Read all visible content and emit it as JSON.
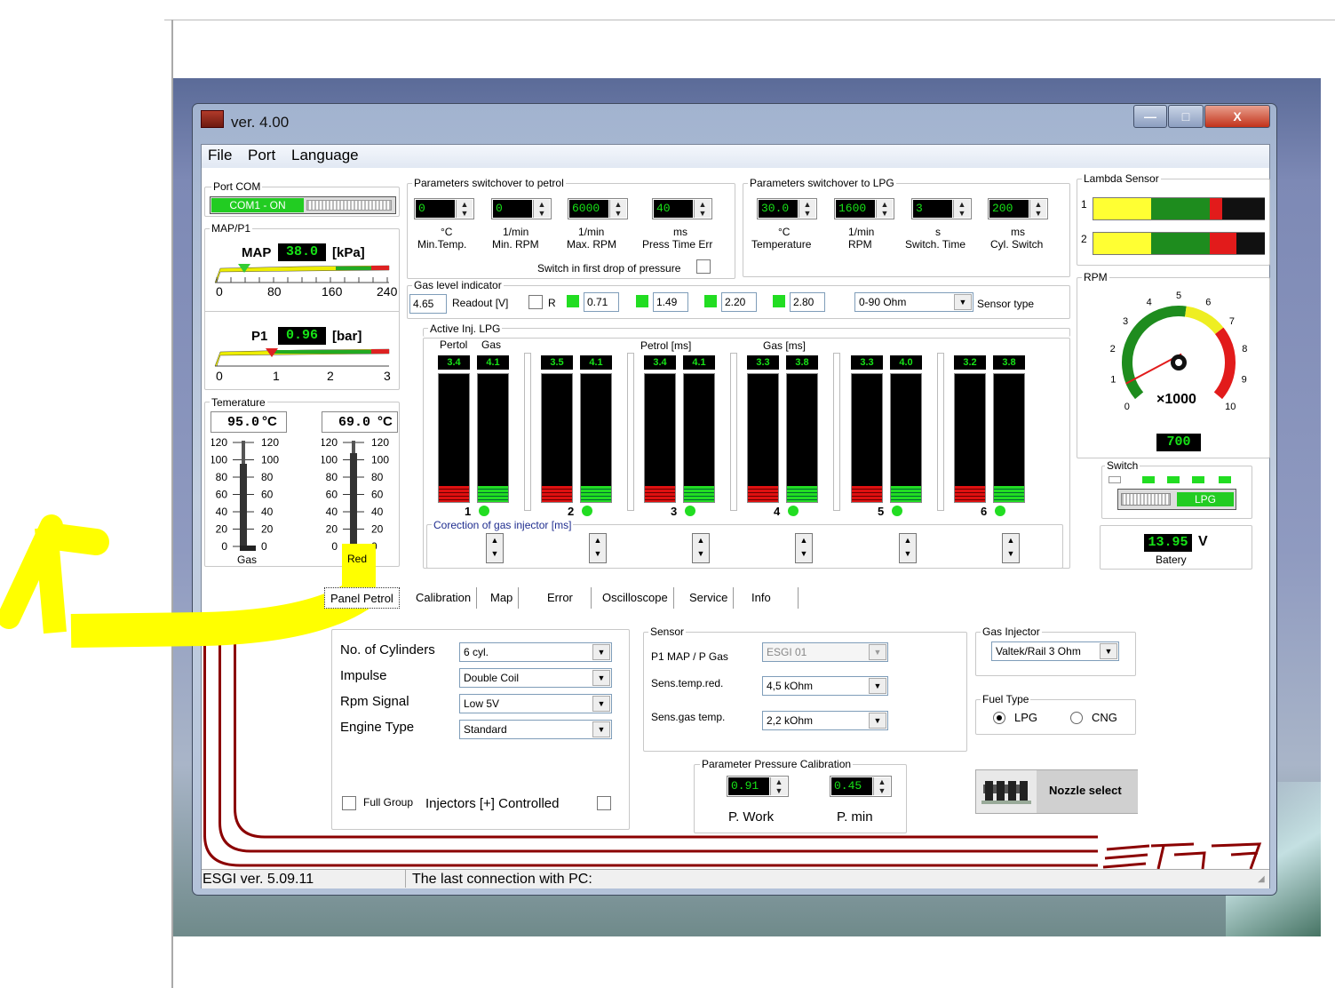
{
  "window": {
    "title": "ver. 4.00",
    "min_symbol": "—",
    "max_symbol": "□",
    "close_symbol": "X"
  },
  "menu": [
    "File",
    "Port",
    "Language"
  ],
  "port_com": {
    "legend": "Port COM",
    "status": "COM1 - ON"
  },
  "map_p1": {
    "legend": "MAP/P1",
    "map_label": "MAP",
    "map_value": "38.0",
    "map_unit": "[kPa]",
    "map_scale": [
      "0",
      "80",
      "160",
      "240"
    ],
    "map_level": 0.16,
    "p1_label": "P1",
    "p1_value": "0.96",
    "p1_unit": "[bar]",
    "p1_scale": [
      "0",
      "1",
      "2",
      "3"
    ],
    "p1_level": 0.32
  },
  "temperature": {
    "legend": "Temerature",
    "gas_value": "95.0",
    "red_value": "69.0",
    "unit": "°C",
    "scale_left": [
      "120",
      "100",
      "80",
      "60",
      "40",
      "20",
      "0"
    ],
    "scale_right": [
      "120",
      "100",
      "80",
      "60",
      "40",
      "20",
      "0"
    ],
    "gas_label": "Gas",
    "red_label": "Red"
  },
  "sw_petrol": {
    "legend": "Parameters switchover to petrol",
    "fields": [
      {
        "value": "0",
        "unit": "°C",
        "label": "Min.Temp."
      },
      {
        "value": "0",
        "unit": "1/min",
        "label": "Min. RPM"
      },
      {
        "value": "6000",
        "unit": "1/min",
        "label": "Max. RPM"
      },
      {
        "value": "40",
        "unit": "ms",
        "label": "Press Time Err"
      }
    ],
    "first_drop": "Switch in first drop of pressure"
  },
  "sw_lpg": {
    "legend": "Parameters switchover to LPG",
    "fields": [
      {
        "value": "30.0",
        "unit": "°C",
        "label": "Temperature"
      },
      {
        "value": "1600",
        "unit": "1/min",
        "label": "RPM"
      },
      {
        "value": "3",
        "unit": "s",
        "label": "Switch. Time"
      },
      {
        "value": "200",
        "unit": "ms",
        "label": "Cyl. Switch"
      }
    ]
  },
  "gas_level": {
    "legend": "Gas level indicator",
    "readout": "4.65",
    "readout_label": "Readout [V]",
    "r_label": "R",
    "levels": [
      "0.71",
      "1.49",
      "2.20",
      "2.80"
    ],
    "sensor_type_value": "0-90 Ohm",
    "sensor_type_label": "Sensor type"
  },
  "active_inj": {
    "legend": "Active Inj. LPG",
    "petrol_label": "Pertol",
    "gas_label": "Gas",
    "petrol_ms": "Petrol [ms]",
    "gas_ms": "Gas [ms]",
    "cylinders": [
      {
        "n": "1",
        "petrol": "3.4",
        "gas": "4.1"
      },
      {
        "n": "2",
        "petrol": "3.5",
        "gas": "4.1"
      },
      {
        "n": "3",
        "petrol": "3.4",
        "gas": "4.1"
      },
      {
        "n": "4",
        "petrol": "3.3",
        "gas": "3.8"
      },
      {
        "n": "5",
        "petrol": "3.3",
        "gas": "4.0"
      },
      {
        "n": "6",
        "petrol": "3.2",
        "gas": "3.8"
      }
    ],
    "correction_legend": "Corection of gas injector [ms]"
  },
  "lambda": {
    "legend": "Lambda Sensor",
    "rows": [
      "1",
      "2"
    ]
  },
  "rpm": {
    "legend": "RPM",
    "value": "700",
    "multiplier": "×1000",
    "scale": [
      "0",
      "1",
      "2",
      "3",
      "4",
      "5",
      "6",
      "7",
      "8",
      "9",
      "10"
    ],
    "level": 0.07
  },
  "switch": {
    "legend": "Switch",
    "state": "LPG"
  },
  "battery": {
    "value": "13.95",
    "unit": "V",
    "label": "Batery"
  },
  "tabs": [
    "Panel Petrol",
    "Calibration",
    "Map",
    "Error",
    "Oscilloscope",
    "Service",
    "Info"
  ],
  "panel": {
    "rows": [
      {
        "label": "No. of Cylinders",
        "value": "6 cyl."
      },
      {
        "label": "Impulse",
        "value": "Double Coil"
      },
      {
        "label": "Rpm Signal",
        "value": "Low  5V"
      },
      {
        "label": "Engine Type",
        "value": "Standard"
      }
    ],
    "full_group": "Full Group",
    "injectors_controlled": "Injectors [+] Controlled"
  },
  "sensor": {
    "legend": "Sensor",
    "rows": [
      {
        "label": "P1 MAP / P Gas",
        "value": "ESGI 01"
      },
      {
        "label": "Sens.temp.red.",
        "value": "4,5 kOhm"
      },
      {
        "label": "Sens.gas temp.",
        "value": "2,2 kOhm"
      }
    ]
  },
  "pressure_cal": {
    "legend": "Parameter Pressure Calibration",
    "work_value": "0.91",
    "work_label": "P. Work",
    "min_value": "0.45",
    "min_label": "P. min"
  },
  "gas_injector": {
    "legend": "Gas Injector",
    "value": "Valtek/Rail 3 Ohm"
  },
  "fuel_type": {
    "legend": "Fuel Type",
    "options": [
      "LPG",
      "CNG"
    ],
    "selected": "LPG"
  },
  "nozzle": {
    "label": "Nozzle select"
  },
  "statusbar": {
    "version": "ESGI ver. 5.09.11",
    "last_connection": "The last connection with PC:"
  },
  "logo": "ESGI",
  "colors": {
    "digit_green": "#17e317",
    "annotation_yellow": "#ffff00",
    "brand_red": "#8b0000"
  }
}
